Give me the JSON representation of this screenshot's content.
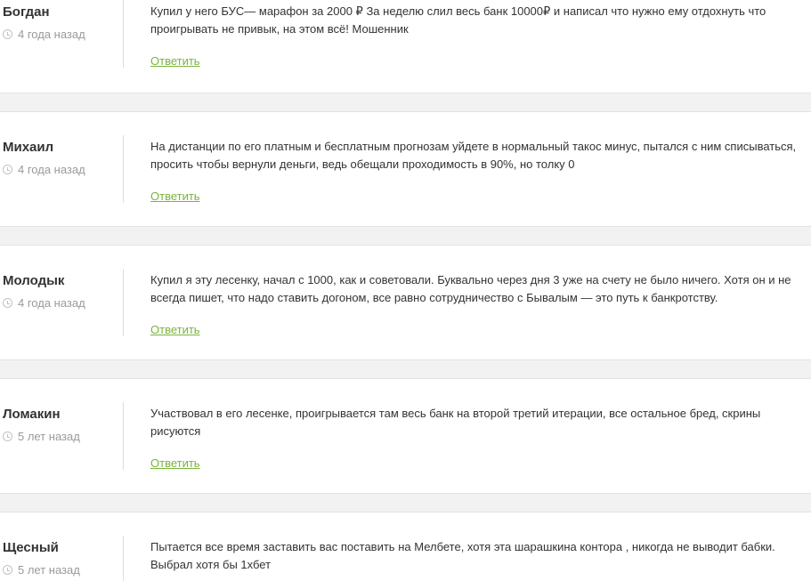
{
  "comments": [
    {
      "author": "Богдан",
      "time": "4 года назад",
      "text": "Купил у него БУС— марафон за 2000 ₽ За неделю слил весь банк 10000₽ и написал что нужно ему отдохнуть что проигрывать не привык, на этом всё! Мошенник",
      "reply": "Ответить"
    },
    {
      "author": "Михаил",
      "time": "4 года назад",
      "text": "На дистанции по его платным и бесплатным прогнозам уйдете в нормальный такос минус, пытался с ним списываться, просить чтобы вернули деньги, ведь обещали проходимость в 90%, но толку 0",
      "reply": "Ответить"
    },
    {
      "author": "Молодык",
      "time": "4 года назад",
      "text": "Купил я эту лесенку, начал с 1000, как и советовали. Буквально через дня 3 уже на счету не было ничего. Хотя он и не всегда пишет, что надо ставить догоном, все равно сотрудничество с Бывалым — это путь к банкротству.",
      "reply": "Ответить"
    },
    {
      "author": "Ломакин",
      "time": "5 лет назад",
      "text": "Участвовал в его лесенке, проигрывается там весь банк на второй третий итерации, все остальное бред, скрины рисуются",
      "reply": "Ответить"
    },
    {
      "author": "Щесный",
      "time": "5 лет назад",
      "text": "Пытается все время заставить вас поставить на Мелбете, хотя эта шарашкина контора , никогда не выводит бабки. Выбрал хотя бы 1хбет",
      "reply": ""
    }
  ]
}
